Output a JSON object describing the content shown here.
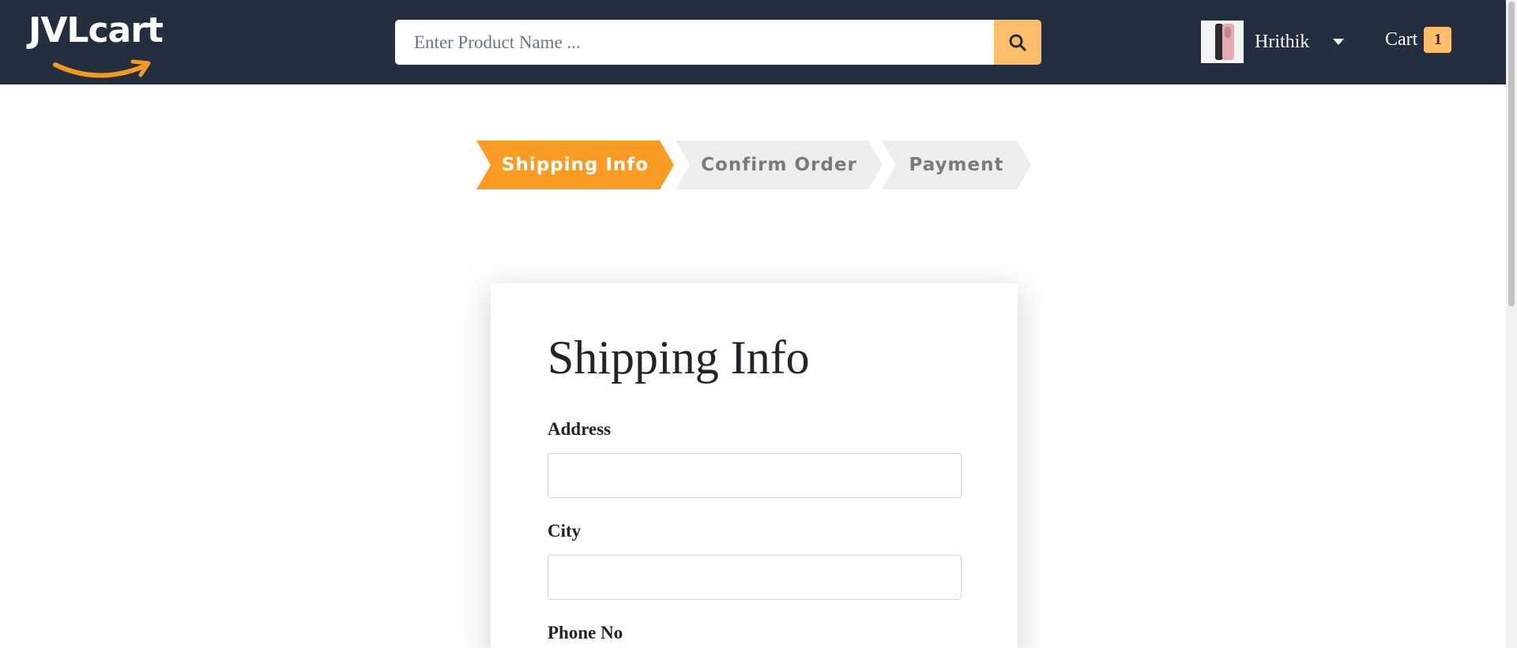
{
  "header": {
    "logo_text": "JVLcart",
    "search": {
      "placeholder": "Enter Product Name ...",
      "value": ""
    },
    "user": {
      "name": "Hrithik"
    },
    "cart": {
      "label": "Cart",
      "count": "1"
    }
  },
  "steps": [
    {
      "label": "Shipping Info",
      "active": true
    },
    {
      "label": "Confirm Order",
      "active": false
    },
    {
      "label": "Payment",
      "active": false
    }
  ],
  "form": {
    "title": "Shipping Info",
    "fields": [
      {
        "label": "Address",
        "value": ""
      },
      {
        "label": "City",
        "value": ""
      },
      {
        "label": "Phone No",
        "value": ""
      }
    ]
  },
  "colors": {
    "header_bg": "#232f3e",
    "accent": "#febd69",
    "step_active": "#fa9c23",
    "step_idle": "#eeeeee"
  }
}
